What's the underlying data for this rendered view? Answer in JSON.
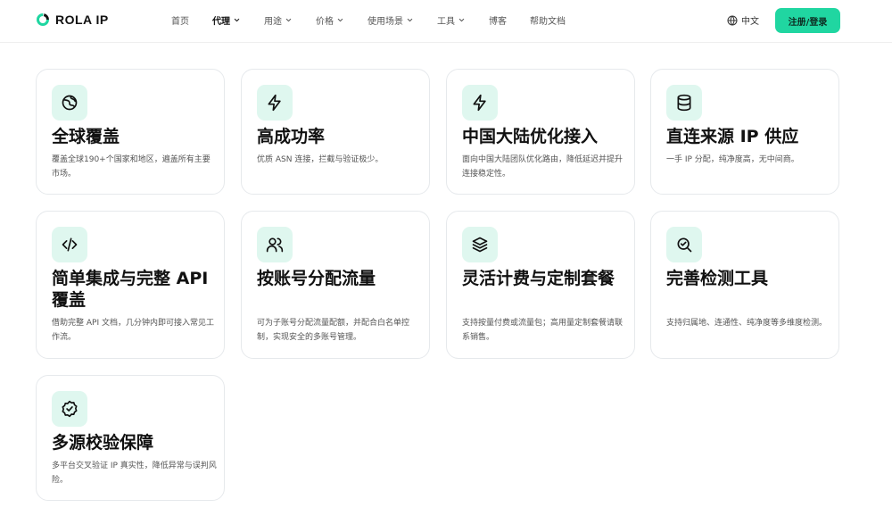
{
  "brand": {
    "name": "ROLA IP",
    "accent": "#20d6a1",
    "icon_bg": "#dff7ef"
  },
  "nav": {
    "items": [
      {
        "label": "首页",
        "has_dropdown": false,
        "active": false
      },
      {
        "label": "代理",
        "has_dropdown": true,
        "active": true
      },
      {
        "label": "用途",
        "has_dropdown": true,
        "active": false
      },
      {
        "label": "价格",
        "has_dropdown": true,
        "active": false
      },
      {
        "label": "使用场景",
        "has_dropdown": true,
        "active": false
      },
      {
        "label": "工具",
        "has_dropdown": true,
        "active": false
      },
      {
        "label": "博客",
        "has_dropdown": false,
        "active": false
      },
      {
        "label": "帮助文档",
        "has_dropdown": false,
        "active": false
      }
    ],
    "language": "中文",
    "login_label": "注册/登录"
  },
  "features": [
    {
      "icon": "globe-icon",
      "title": "全球覆盖",
      "desc": "覆盖全球190+个国家和地区，遍盖所有主要市场。"
    },
    {
      "icon": "lightning-icon",
      "title": "高成功率",
      "desc": "优质 ASN 连接，拦截与验证极少。"
    },
    {
      "icon": "lightning-icon",
      "title": "中国大陆优化接入",
      "desc": "面向中国大陆团队优化路由，降低延迟并提升连接稳定性。"
    },
    {
      "icon": "database-icon",
      "title": "直连来源 IP 供应",
      "desc": "一手 IP 分配，纯净度高，无中间商。"
    },
    {
      "icon": "code-icon",
      "title": "简单集成与完整 API 覆盖",
      "desc": "借助完整 API 文档，几分钟内即可接入常见工作流。"
    },
    {
      "icon": "users-icon",
      "title": "按账号分配流量",
      "desc": "可为子账号分配流量配额，并配合白名单控制，实现安全的多账号管理。"
    },
    {
      "icon": "layers-icon",
      "title": "灵活计费与定制套餐",
      "desc": "支持按量付费或流量包；高用量定制套餐请联系销售。"
    },
    {
      "icon": "search-check-icon",
      "title": "完善检测工具",
      "desc": "支持归属地、连通性、纯净度等多维度检测。"
    },
    {
      "icon": "badge-check-icon",
      "title": "多源校验保障",
      "desc": "多平台交叉验证 IP 真实性，降低异常与误判风险。"
    }
  ]
}
